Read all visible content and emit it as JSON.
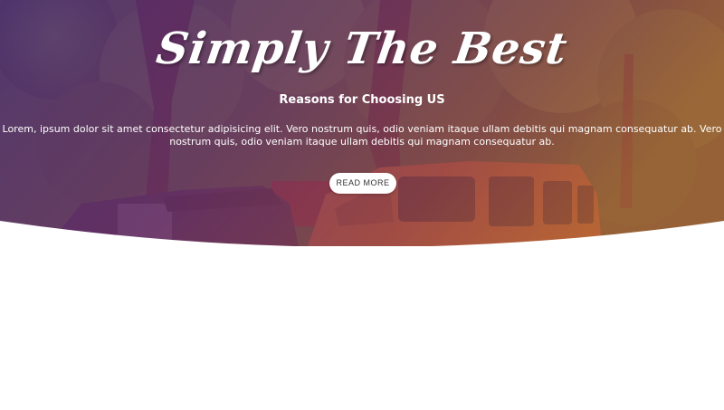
{
  "hero": {
    "title": "Simply The Best",
    "subtitle": "Reasons for Choosing US",
    "text": "Lorem, ipsum dolor sit amet consectetur adipisicing elit. Vero nostrum quis, odio veniam itaque ullam debitis qui magnam consequatur ab. Vero nostrum quis, odio veniam itaque ullam debitis qui magnam consequatur ab.",
    "button_label": "READ MORE"
  },
  "colors": {
    "overlay_left": "#6a2a8a",
    "overlay_right": "#b4543a",
    "text": "#ffffff",
    "button_bg": "#ffffff",
    "button_text": "#333333"
  }
}
